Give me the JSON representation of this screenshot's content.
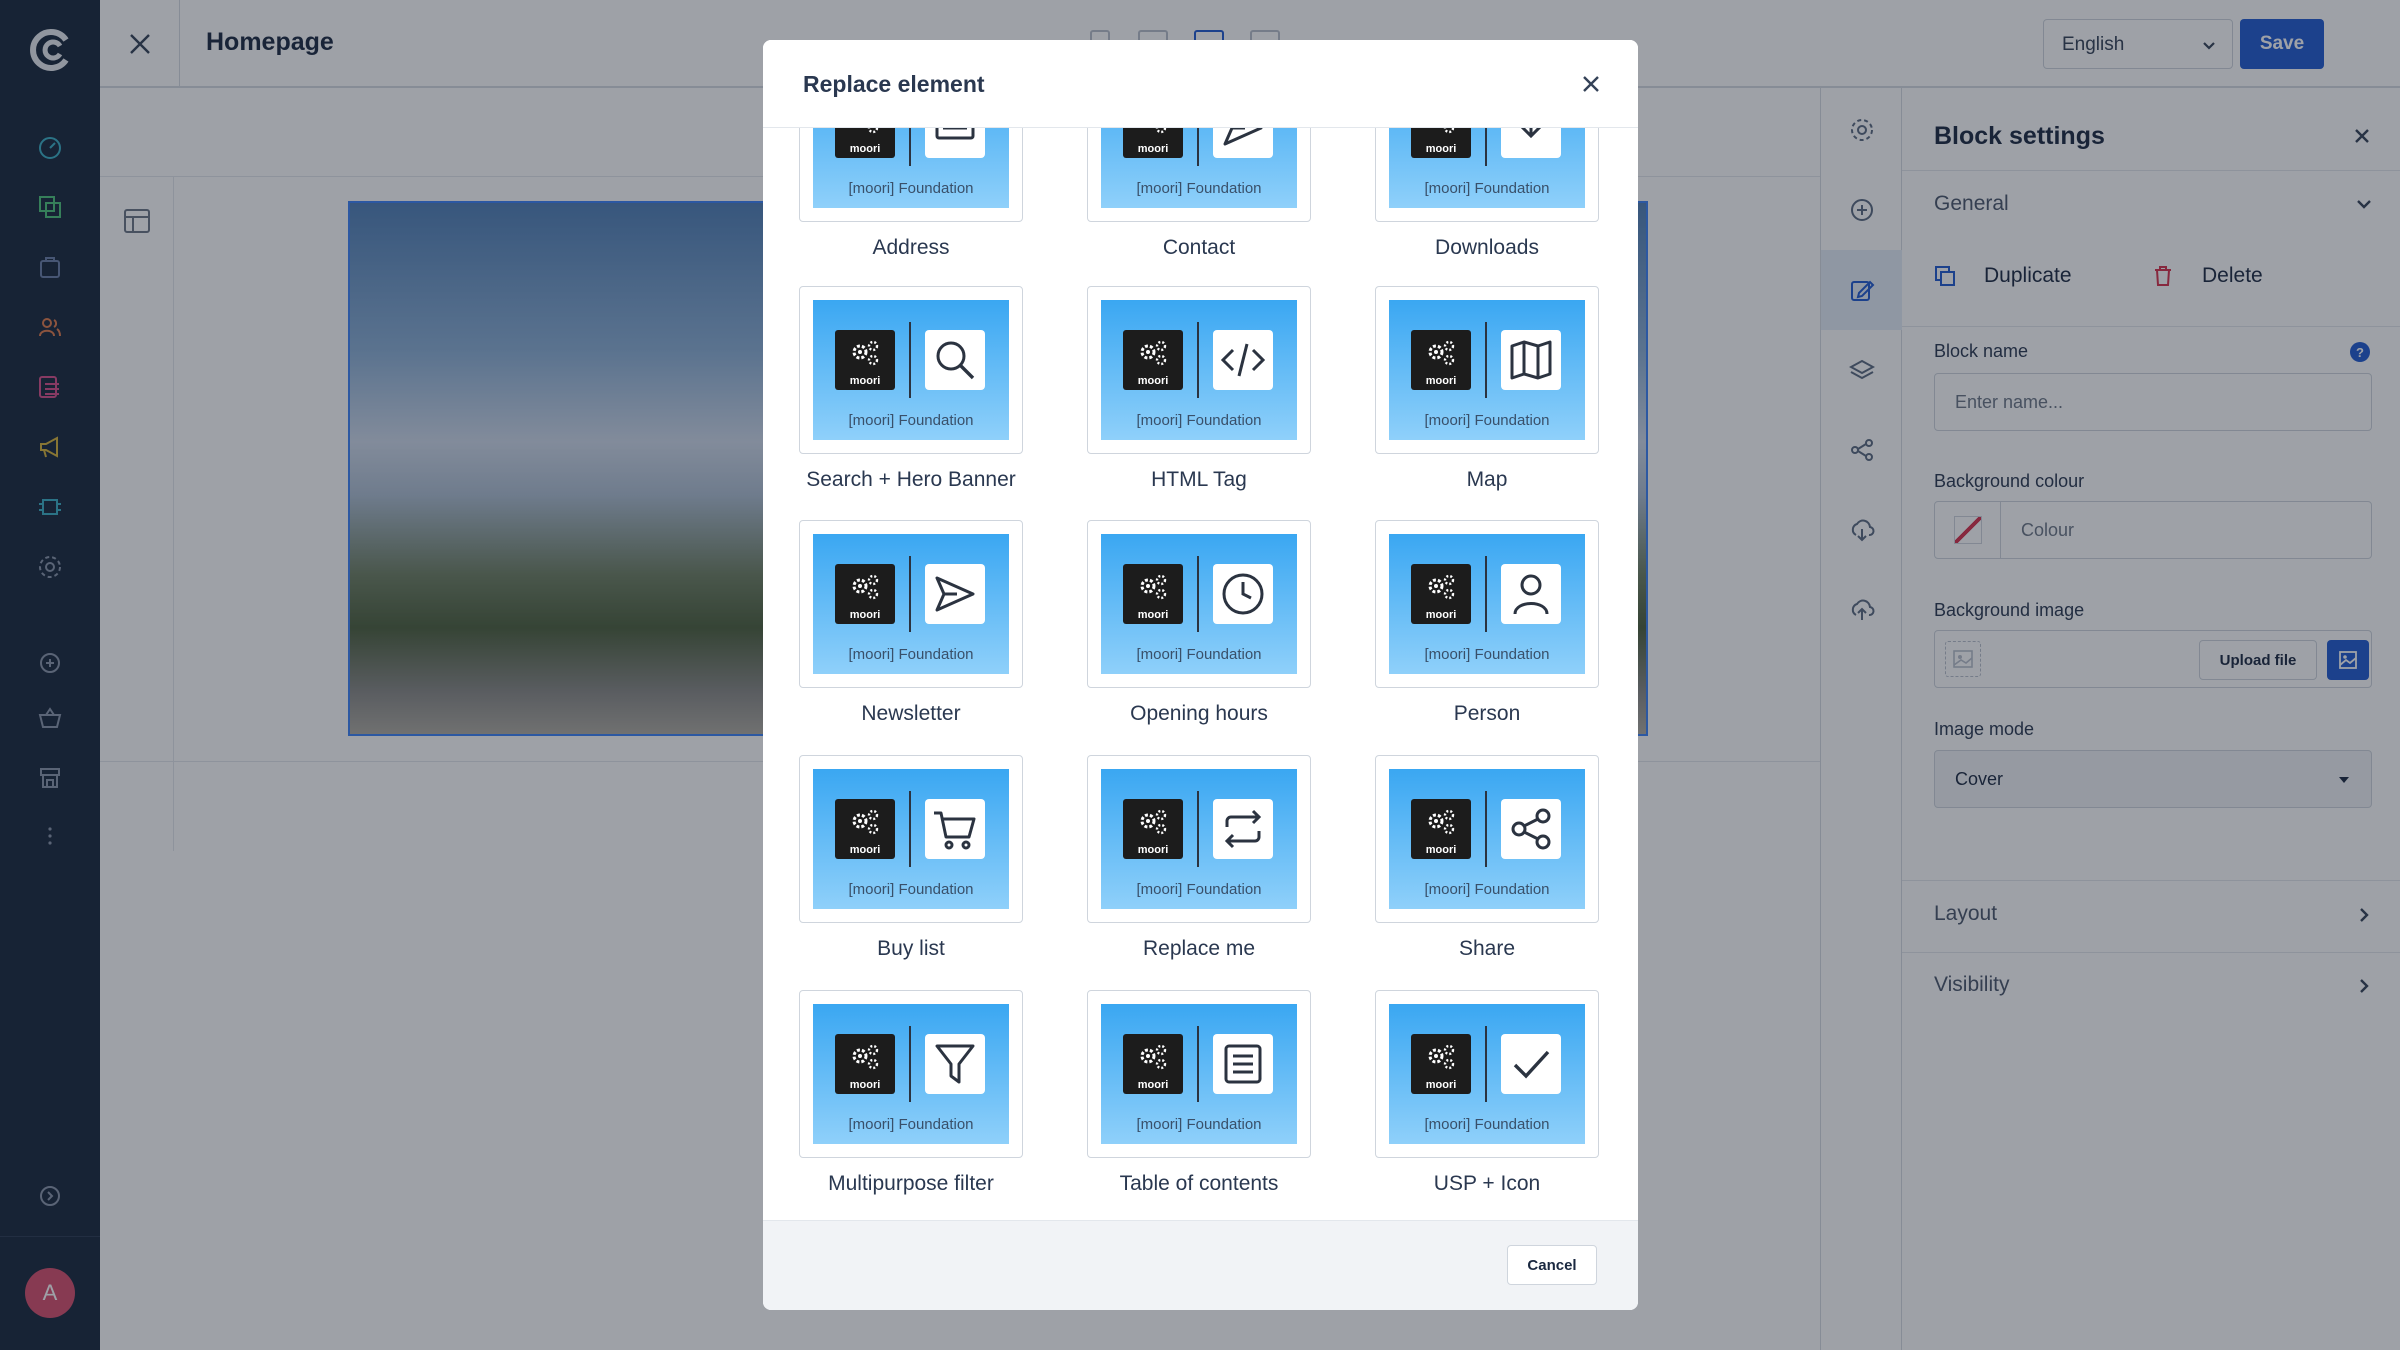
{
  "topbar": {
    "title": "Homepage",
    "language": "English",
    "save_label": "Save"
  },
  "nav": {
    "avatar_initial": "A",
    "icons": [
      "dashboard-icon",
      "catalog-icon",
      "orders-icon",
      "customers-icon",
      "content-icon",
      "marketing-icon",
      "extensions-icon",
      "settings-icon",
      "add-icon",
      "basket-icon",
      "store-icon",
      "more-icon",
      "expand-icon"
    ]
  },
  "panel": {
    "title": "Block settings",
    "general_label": "General",
    "duplicate_label": "Duplicate",
    "delete_label": "Delete",
    "block_name_label": "Block name",
    "block_name_placeholder": "Enter name...",
    "help_mark": "?",
    "bg_colour_label": "Background colour",
    "colour_text": "Colour",
    "bg_image_label": "Background image",
    "upload_label": "Upload file",
    "image_mode_label": "Image mode",
    "image_mode_value": "Cover",
    "layout_label": "Layout",
    "visibility_label": "Visibility"
  },
  "modal": {
    "title": "Replace element",
    "cancel_label": "Cancel",
    "brand": "moori",
    "caption": "[moori] Foundation",
    "elements": [
      {
        "label": "Address",
        "icon": "address-icon"
      },
      {
        "label": "Contact",
        "icon": "send-icon"
      },
      {
        "label": "Downloads",
        "icon": "download-icon"
      },
      {
        "label": "Search + Hero Banner",
        "icon": "search-icon"
      },
      {
        "label": "HTML Tag",
        "icon": "code-icon"
      },
      {
        "label": "Map",
        "icon": "map-icon"
      },
      {
        "label": "Newsletter",
        "icon": "send-icon"
      },
      {
        "label": "Opening hours",
        "icon": "clock-icon"
      },
      {
        "label": "Person",
        "icon": "person-icon"
      },
      {
        "label": "Buy list",
        "icon": "cart-icon"
      },
      {
        "label": "Replace me",
        "icon": "repeat-icon"
      },
      {
        "label": "Share",
        "icon": "share-icon"
      },
      {
        "label": "Multipurpose filter",
        "icon": "filter-icon"
      },
      {
        "label": "Table of contents",
        "icon": "list-icon"
      },
      {
        "label": "USP + Icon",
        "icon": "check-icon"
      }
    ]
  },
  "colors": {
    "nav_bg": "#17263b",
    "accent": "#1f5ad1",
    "thumb_top": "#3aa7f2",
    "thumb_bottom": "#8fd0fa"
  }
}
